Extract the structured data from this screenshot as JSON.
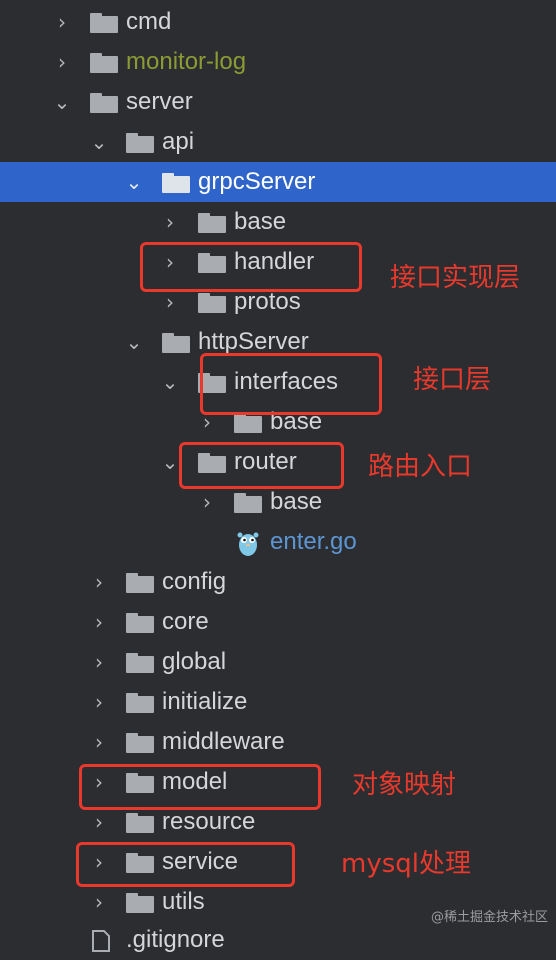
{
  "tree": [
    {
      "label": "cmd",
      "expanded": false,
      "style": "normal"
    },
    {
      "label": "monitor-log",
      "expanded": false,
      "style": "olive"
    },
    {
      "label": "server",
      "expanded": true,
      "style": "normal"
    },
    {
      "label": "api",
      "expanded": true,
      "style": "normal"
    },
    {
      "label": "grpcServer",
      "expanded": true,
      "style": "normal",
      "selected": true
    },
    {
      "label": "base",
      "expanded": false,
      "style": "normal"
    },
    {
      "label": "handler",
      "expanded": false,
      "style": "normal"
    },
    {
      "label": "protos",
      "expanded": false,
      "style": "normal"
    },
    {
      "label": "httpServer",
      "expanded": true,
      "style": "normal"
    },
    {
      "label": "interfaces",
      "expanded": true,
      "style": "normal"
    },
    {
      "label": "base",
      "expanded": false,
      "style": "normal"
    },
    {
      "label": "router",
      "expanded": true,
      "style": "normal"
    },
    {
      "label": "base",
      "expanded": false,
      "style": "normal"
    },
    {
      "label": "enter.go",
      "type": "go-file",
      "style": "blue"
    },
    {
      "label": "config",
      "expanded": false,
      "style": "normal"
    },
    {
      "label": "core",
      "expanded": false,
      "style": "normal"
    },
    {
      "label": "global",
      "expanded": false,
      "style": "normal"
    },
    {
      "label": "initialize",
      "expanded": false,
      "style": "normal"
    },
    {
      "label": "middleware",
      "expanded": false,
      "style": "normal"
    },
    {
      "label": "model",
      "expanded": false,
      "style": "normal"
    },
    {
      "label": "resource",
      "expanded": false,
      "style": "normal"
    },
    {
      "label": "service",
      "expanded": false,
      "style": "normal"
    },
    {
      "label": "utils",
      "expanded": false,
      "style": "normal"
    },
    {
      "label": ".gitignore",
      "type": "file",
      "style": "normal"
    }
  ],
  "annotations": {
    "handler": "接口实现层",
    "interfaces": "接口层",
    "router": "路由入口",
    "model": "对象映射",
    "service": "mysql处理"
  },
  "watermark": "@稀土掘金技术社区",
  "colors": {
    "background": "#2b2d30",
    "selected": "#2f65ca",
    "annotation_red": "#e8392c",
    "folder": "#a9acb1",
    "olive_text": "#8c9b33",
    "go_file_text": "#5d95d2"
  },
  "icons": {
    "collapsed": "chevron-right-icon",
    "expanded": "chevron-down-icon",
    "folder": "folder-icon",
    "go_file": "gopher-icon",
    "file": "file-icon"
  }
}
